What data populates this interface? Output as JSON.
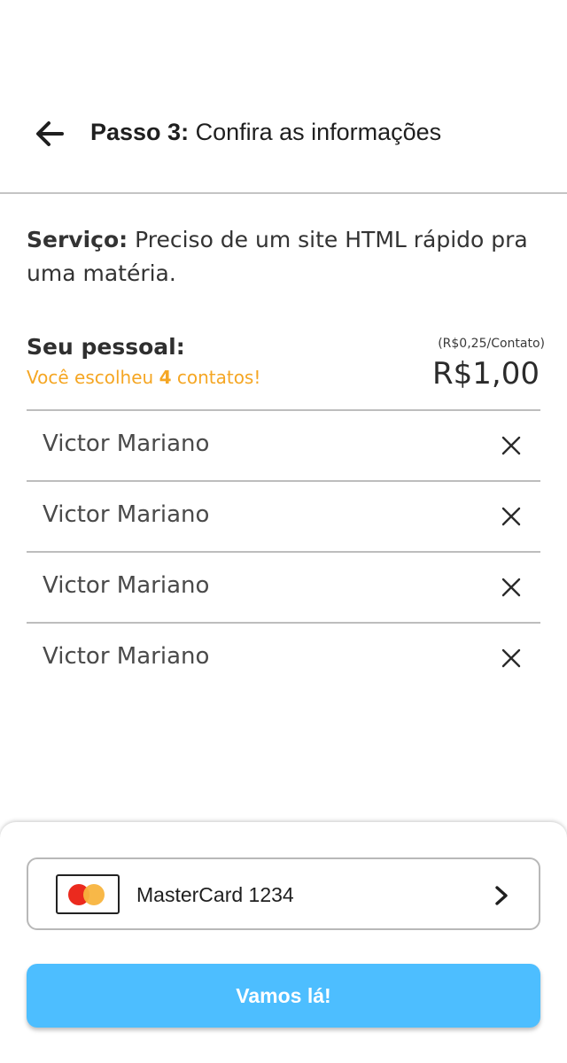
{
  "header": {
    "title_bold": "Passo 3:",
    "title_rest": " Confira as informações",
    "back_icon": "arrow-left-icon"
  },
  "service": {
    "label": "Serviço:",
    "text": " Preciso de um site HTML rápido pra uma matéria."
  },
  "staff": {
    "label": "Seu pessoal:",
    "note_prefix": "Você escolheu ",
    "note_count": "4",
    "note_suffix": " contatos!",
    "unit_price": "(R$0,25/Contato)",
    "total": "R$1,00",
    "note_color": "#f5a623"
  },
  "contacts": [
    {
      "name": "Victor Mariano",
      "remove_icon": "close-icon"
    },
    {
      "name": "Victor Mariano",
      "remove_icon": "close-icon"
    },
    {
      "name": "Victor Mariano",
      "remove_icon": "close-icon"
    },
    {
      "name": "Victor Mariano",
      "remove_icon": "close-icon"
    }
  ],
  "payment": {
    "card_label": "MasterCard 1234",
    "card_icon": "mastercard-icon",
    "chevron_icon": "chevron-right-icon"
  },
  "cta": {
    "label": "Vamos lá!",
    "color": "#4dbeff"
  }
}
